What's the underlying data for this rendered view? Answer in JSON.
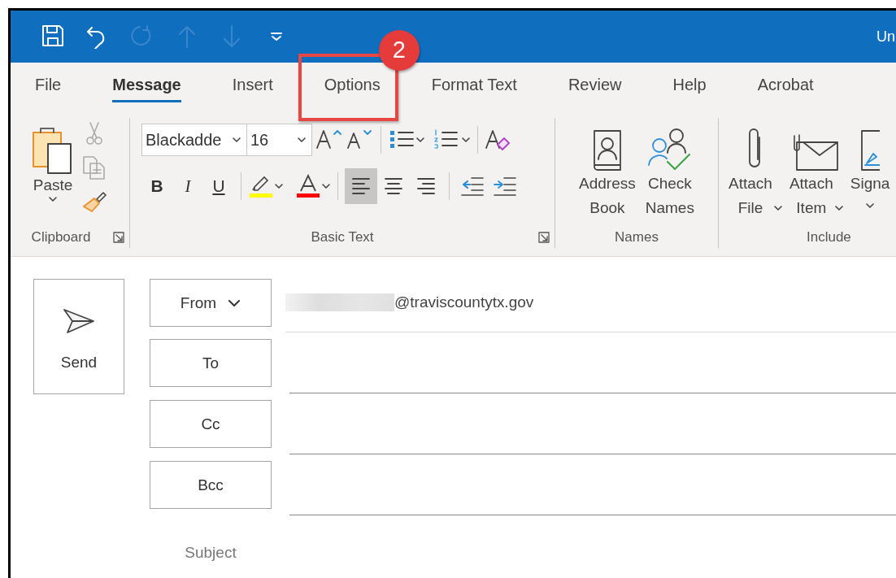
{
  "window": {
    "title": "Un"
  },
  "quick_access": [
    {
      "kind": "save",
      "disabled": false
    },
    {
      "kind": "undo",
      "disabled": false
    },
    {
      "kind": "redo",
      "disabled": true
    },
    {
      "kind": "up",
      "disabled": true
    },
    {
      "kind": "down",
      "disabled": true
    },
    {
      "kind": "customize",
      "disabled": false
    }
  ],
  "tabs": [
    {
      "label": "File",
      "selected": false
    },
    {
      "label": "Message",
      "selected": true
    },
    {
      "label": "Insert",
      "selected": false
    },
    {
      "label": "Options",
      "selected": false,
      "callout": "2"
    },
    {
      "label": "Format Text",
      "selected": false
    },
    {
      "label": "Review",
      "selected": false
    },
    {
      "label": "Help",
      "selected": false
    },
    {
      "label": "Acrobat",
      "selected": false
    }
  ],
  "ribbon": {
    "clipboard": {
      "label": "Clipboard",
      "paste": "Paste"
    },
    "basic_text": {
      "label": "Basic Text",
      "font": "Blackadde",
      "size": "16",
      "styles": [
        "B",
        "I",
        "U"
      ],
      "alignment": [
        {
          "kind": "left",
          "selected": true
        },
        {
          "kind": "center",
          "selected": false
        },
        {
          "kind": "right",
          "selected": false
        }
      ]
    },
    "names": {
      "label": "Names",
      "buttons": [
        {
          "kind": "address-book",
          "label": "Address Book"
        },
        {
          "kind": "check-names",
          "label": "Check Names"
        }
      ]
    },
    "include": {
      "label": "Include",
      "buttons": [
        {
          "kind": "attach-file",
          "label": "Attach File",
          "dropdown": true
        },
        {
          "kind": "attach-item",
          "label": "Attach Item",
          "dropdown": true
        },
        {
          "kind": "signature",
          "label": "Signa",
          "dropdown": true
        }
      ]
    }
  },
  "compose": {
    "send": "Send",
    "from": {
      "label": "From",
      "value": "@traviscountytx.gov",
      "redacted": true
    },
    "recipients": [
      {
        "label": "To"
      },
      {
        "label": "Cc"
      },
      {
        "label": "Bcc"
      }
    ],
    "subject": {
      "label": "Subject"
    }
  }
}
